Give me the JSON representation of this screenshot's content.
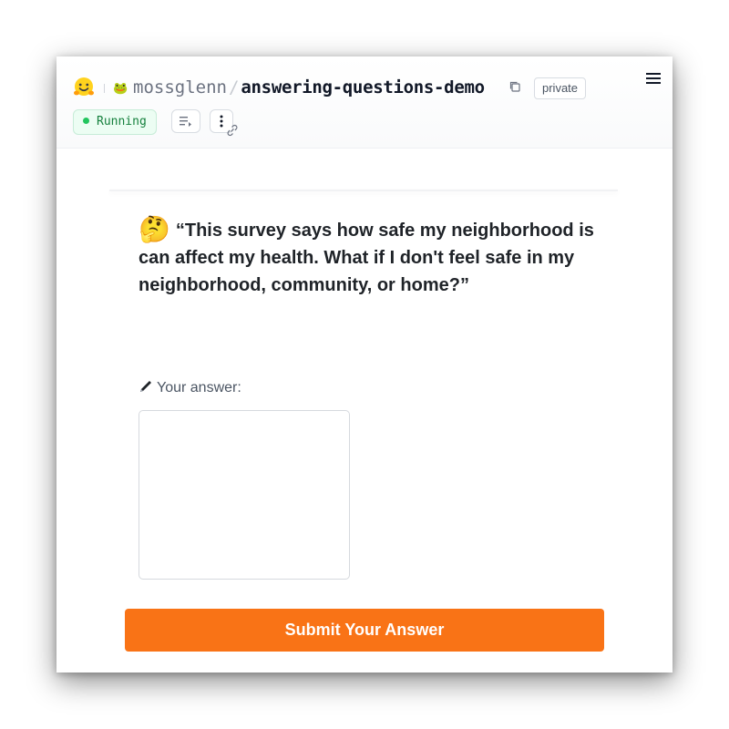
{
  "header": {
    "owner": "mossglenn",
    "owner_avatar": "🐸",
    "separator": "/",
    "repo": "answering-questions-demo",
    "visibility": "private",
    "status": "Running",
    "status_color": "#22c55e",
    "icons": {
      "logo": "huggingface-logo-icon",
      "copy": "copy-icon",
      "menu": "hamburger-menu-icon",
      "logs": "logs-icon",
      "more": "more-vertical-icon",
      "link": "link-icon"
    }
  },
  "main": {
    "question_emoji": "🤔",
    "question": "“This survey says how safe my neighborhood is can affect my health. What if I don't feel safe in my neighborhood, community, or home?”",
    "answer_label": "Your answer:",
    "answer_value": "",
    "submit_label": "Submit Your Answer",
    "accent_color": "#f97316"
  }
}
